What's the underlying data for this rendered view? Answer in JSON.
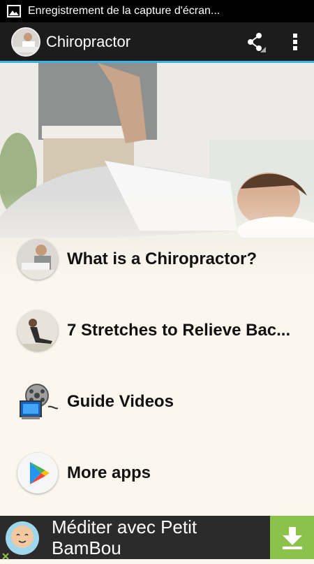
{
  "status_bar": {
    "notification_text": "Enregistrement de la capture d'écran..."
  },
  "app_bar": {
    "title": "Chiropractor"
  },
  "menu": {
    "items": [
      {
        "label": "What is a Chiropractor?",
        "icon": "chiropractor-thumbnail"
      },
      {
        "label": "7 Stretches to Relieve Bac...",
        "icon": "stretch-thumbnail"
      },
      {
        "label": "Guide Videos",
        "icon": "film-reel-icon"
      },
      {
        "label": "More apps",
        "icon": "play-store-icon"
      }
    ]
  },
  "ad": {
    "line1": "Méditer avec Petit",
    "line2": "BamBou"
  },
  "colors": {
    "action_bar": "#1c1c1c",
    "accent_line": "#33b5e5",
    "background": "#fbf7ee",
    "ad_download": "#8bc34a"
  }
}
